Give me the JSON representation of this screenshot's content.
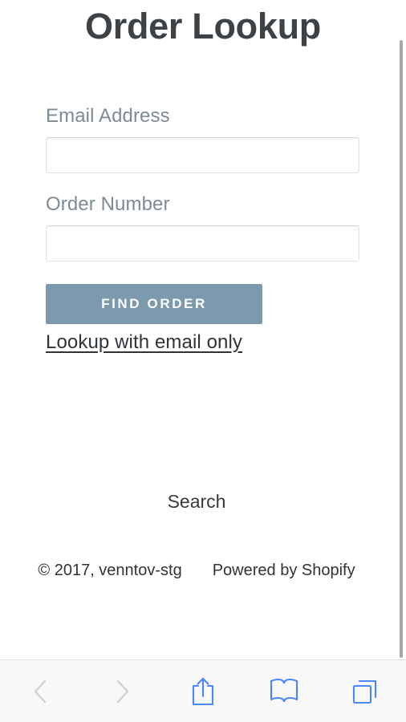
{
  "page": {
    "title": "Order Lookup",
    "background_color": "#ffffff"
  },
  "form": {
    "fields": [
      {
        "label": "Email Address",
        "value": "",
        "placeholder": "",
        "name": "email-address-input"
      },
      {
        "label": "Order Number",
        "value": "",
        "placeholder": "",
        "name": "order-number-input"
      }
    ],
    "submit_label": "FIND ORDER",
    "submit_color": "#7b9aad",
    "secondary_link_label": "Lookup with email only"
  },
  "navigation": {
    "search_label": "Search"
  },
  "footer": {
    "copyright": "© 2017, venntov-stg",
    "powered_by": "Powered by Shopify"
  },
  "browser_toolbar": {
    "buttons": [
      {
        "name": "back-button",
        "icon": "chevron-left-icon",
        "enabled": false
      },
      {
        "name": "forward-button",
        "icon": "chevron-right-icon",
        "enabled": false
      },
      {
        "name": "share-button",
        "icon": "share-icon",
        "enabled": true
      },
      {
        "name": "bookmarks-button",
        "icon": "book-icon",
        "enabled": true
      },
      {
        "name": "tabs-button",
        "icon": "tabs-icon",
        "enabled": true
      }
    ],
    "active_color": "#4a86f7",
    "disabled_color": "#cfcfcf",
    "background_color": "#f8f8f8"
  },
  "scrollbar": {
    "color": "#a8a8a8",
    "orientation": "vertical"
  }
}
